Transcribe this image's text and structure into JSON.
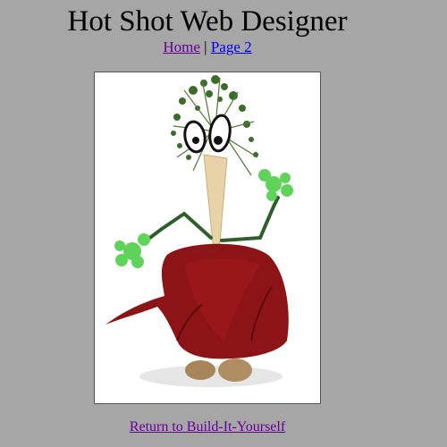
{
  "page": {
    "title": "Hot Shot Web Designer"
  },
  "nav": {
    "home_label": "Home",
    "separator": "|",
    "page2_label": "Page 2"
  },
  "footer": {
    "return_label": "Return to Build-It-Yourself"
  },
  "colors": {
    "background": "#a6a6a6",
    "visited_link": "#660099",
    "unvisited_link": "#0000ee"
  }
}
